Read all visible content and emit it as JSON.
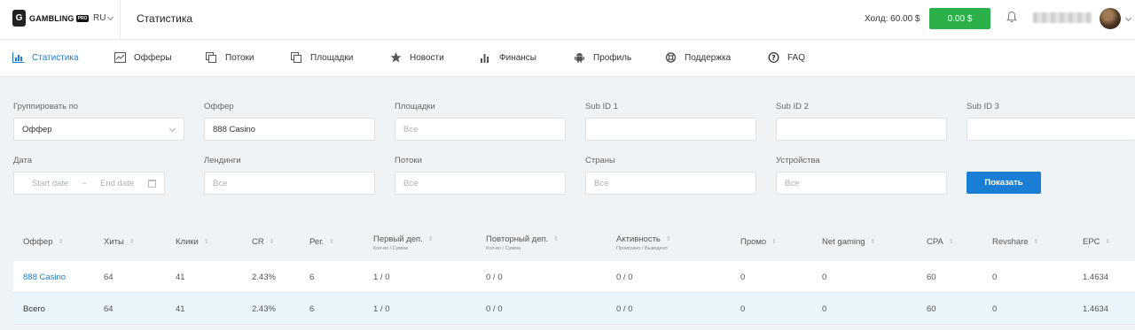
{
  "header": {
    "logo_text": "GAMBLING",
    "logo_badge": "PRO",
    "logo_mark": "G",
    "language": "RU",
    "page_title": "Статистика",
    "hold": "Холд: 60.00 $",
    "balance": "0.00 $"
  },
  "nav": {
    "items": [
      {
        "label": "Статистика",
        "icon": "bar-chart-icon",
        "active": true
      },
      {
        "label": "Офферы",
        "icon": "line-chart-icon"
      },
      {
        "label": "Потоки",
        "icon": "copy-icon"
      },
      {
        "label": "Площадки",
        "icon": "copy-icon"
      },
      {
        "label": "Новости",
        "icon": "star-icon"
      },
      {
        "label": "Финансы",
        "icon": "bars-icon"
      },
      {
        "label": "Профиль",
        "icon": "android-icon"
      },
      {
        "label": "Поддержка",
        "icon": "lifebuoy-icon"
      },
      {
        "label": "FAQ",
        "icon": "question-icon"
      }
    ]
  },
  "filters": {
    "group_by": {
      "label": "Группировать по",
      "value": "Оффер"
    },
    "offer": {
      "label": "Оффер",
      "value": "888 Casino"
    },
    "platforms": {
      "label": "Площадки",
      "placeholder": "Все"
    },
    "sub1": {
      "label": "Sub ID 1",
      "value": ""
    },
    "sub2": {
      "label": "Sub ID 2",
      "value": ""
    },
    "sub3": {
      "label": "Sub ID 3",
      "value": ""
    },
    "date": {
      "label": "Дата",
      "start": "Start date",
      "separator": "~",
      "end": "End date"
    },
    "landings": {
      "label": "Лендинги",
      "placeholder": "Все"
    },
    "streams": {
      "label": "Потоки",
      "placeholder": "Все"
    },
    "countries": {
      "label": "Страны",
      "placeholder": "Все"
    },
    "devices": {
      "label": "Устройства",
      "placeholder": "Все"
    },
    "show_button": "Показать"
  },
  "table": {
    "sort_glyph": "▲▼",
    "columns": [
      {
        "label": "Оффер",
        "sub": ""
      },
      {
        "label": "Хиты",
        "sub": ""
      },
      {
        "label": "Клики",
        "sub": ""
      },
      {
        "label": "CR",
        "sub": ""
      },
      {
        "label": "Рег.",
        "sub": ""
      },
      {
        "label": "Первый деп.",
        "sub": "Кол-во / Сумма"
      },
      {
        "label": "Повторный деп.",
        "sub": "Кол-во / Сумма"
      },
      {
        "label": "Активность",
        "sub": "Проиграно / Выведено"
      },
      {
        "label": "Промо",
        "sub": ""
      },
      {
        "label": "Net gaming",
        "sub": ""
      },
      {
        "label": "CPA",
        "sub": ""
      },
      {
        "label": "Revshare",
        "sub": ""
      },
      {
        "label": "EPC",
        "sub": ""
      }
    ],
    "rows": [
      [
        "888 Casino",
        "64",
        "41",
        "2.43%",
        "6",
        "1 / 0",
        "0 / 0",
        "0 / 0",
        "0",
        "0",
        "60",
        "0",
        "1.4634"
      ],
      [
        "Всего",
        "64",
        "41",
        "2.43%",
        "6",
        "1 / 0",
        "0 / 0",
        "0 / 0",
        "0",
        "0",
        "60",
        "0",
        "1.4634"
      ]
    ]
  }
}
